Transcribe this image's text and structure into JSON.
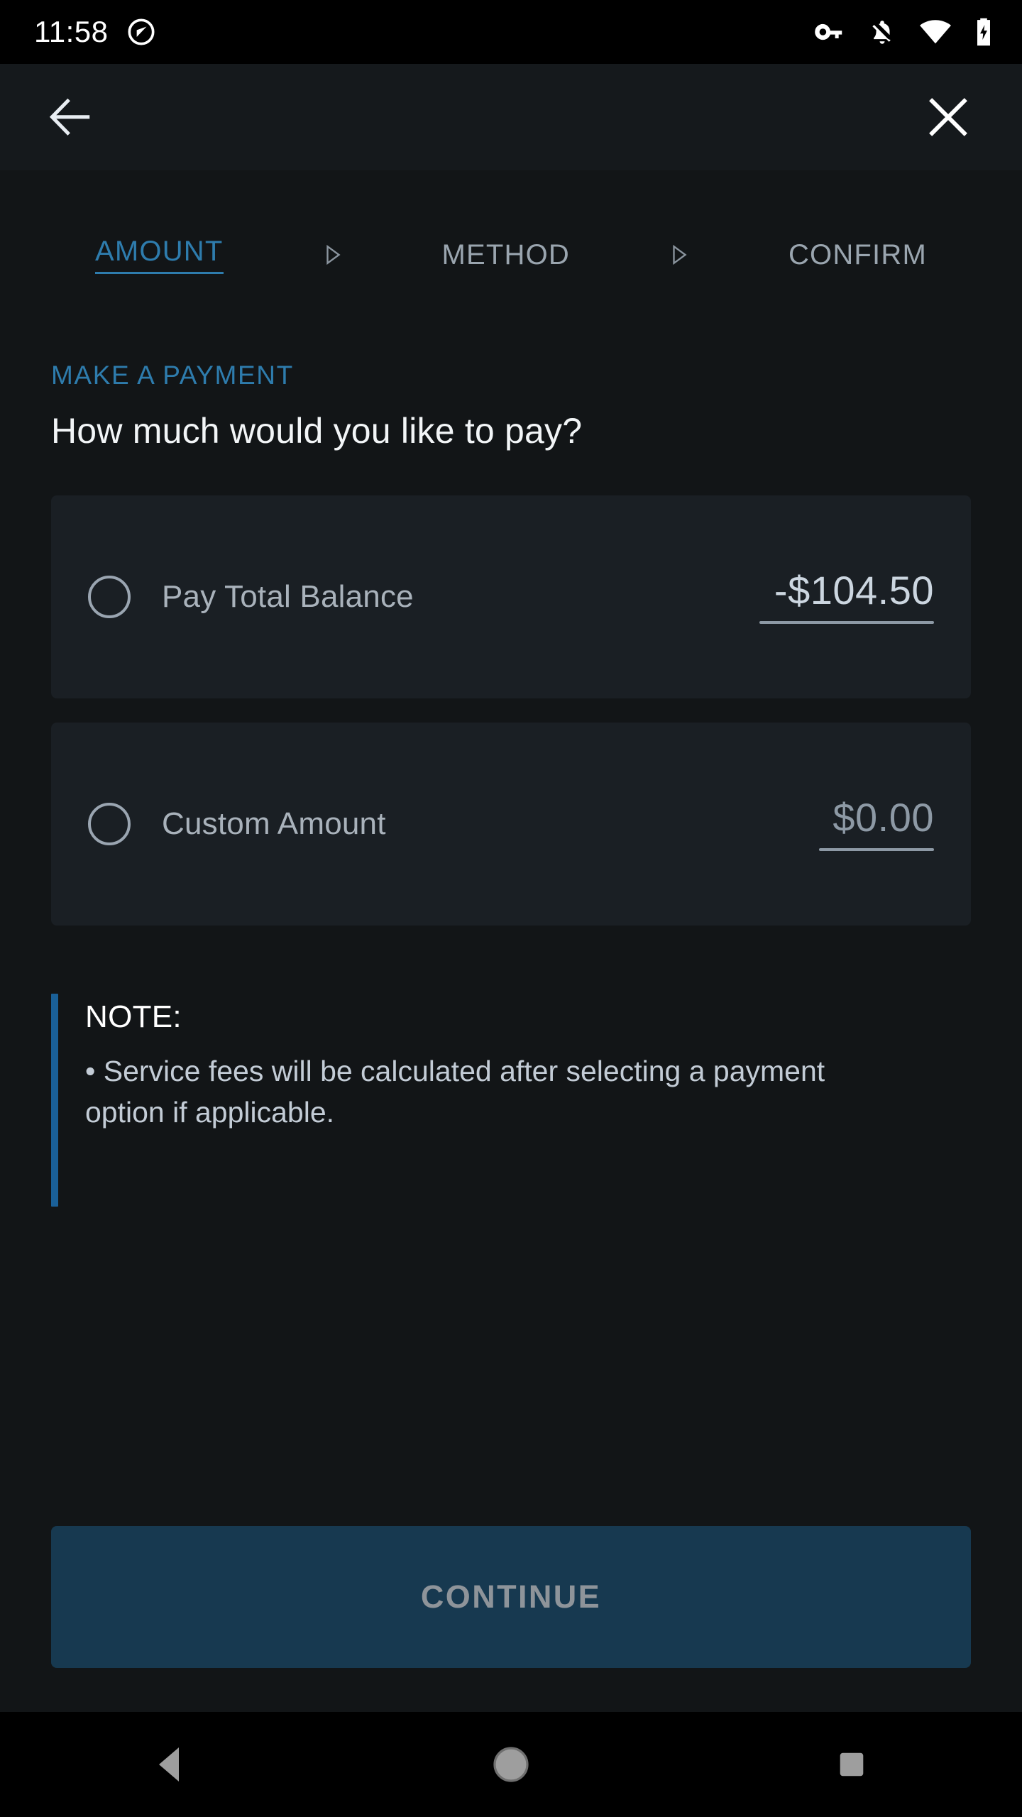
{
  "status_bar": {
    "time": "11:58",
    "icons": [
      "app-badge-icon",
      "vpn-key-icon",
      "notifications-off-icon",
      "wifi-icon",
      "battery-charging-icon"
    ]
  },
  "app_bar": {
    "back_icon": "arrow-back-icon",
    "close_icon": "close-icon"
  },
  "stepper": {
    "steps": [
      {
        "label": "AMOUNT",
        "active": true
      },
      {
        "label": "METHOD",
        "active": false
      },
      {
        "label": "CONFIRM",
        "active": false
      }
    ],
    "separator_icon": "triangle-right-icon",
    "active_color": "#2e7cad",
    "inactive_color": "#9aa5af"
  },
  "section": {
    "eyebrow": "MAKE A PAYMENT",
    "headline": "How much would you like to pay?"
  },
  "options": [
    {
      "label": "Pay Total Balance",
      "amount": "-$104.50",
      "selected": false,
      "radio_icon": "radio-unchecked-icon"
    },
    {
      "label": "Custom Amount",
      "amount": "$0.00",
      "selected": false,
      "radio_icon": "radio-unchecked-icon"
    }
  ],
  "note": {
    "title": "NOTE:",
    "text": "• Service fees will be calculated after selecting a payment option if applicable.",
    "accent_color": "#1a6098"
  },
  "cta": {
    "label": "CONTINUE",
    "background": "#173950",
    "text_color": "#8e949a"
  },
  "nav_bar": {
    "back_icon": "nav-back-triangle-icon",
    "home_icon": "nav-home-circle-icon",
    "recents_icon": "nav-recents-square-icon"
  }
}
